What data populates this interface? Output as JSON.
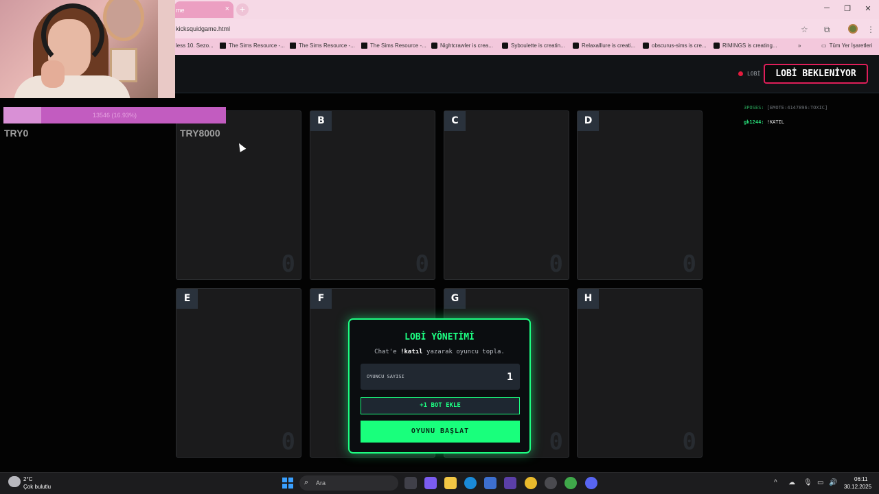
{
  "browser": {
    "tab_title": "me",
    "tab_close": "×",
    "new_tab": "+",
    "url": "kicksquidgame.html",
    "bookmarks": [
      "less 10. Sezo...",
      "The Sims Resource -...",
      "The Sims Resource -...",
      "The Sims Resource -...",
      "Nightcrawler is crea...",
      "Syboulette is creatin...",
      "Relaxalllure is creati...",
      "obscurus-sims is cre...",
      "RIMINGS is creating..."
    ],
    "bookmarks_more": "»",
    "all_bookmarks": "Tüm Yer İşaretleri"
  },
  "webcam": {
    "progress_text": "13546 (16.93%)",
    "progress_fraction": 0.17,
    "try_left": "TRY0",
    "try_right": "TRY8000"
  },
  "game": {
    "lobby_small": "LOBİ",
    "status": "LOBİ BEKLENİYOR",
    "slots": [
      {
        "letter": "",
        "count": "0"
      },
      {
        "letter": "B",
        "count": "0"
      },
      {
        "letter": "C",
        "count": "0"
      },
      {
        "letter": "D",
        "count": "0"
      },
      {
        "letter": "E",
        "count": "0"
      },
      {
        "letter": "F",
        "count": "0"
      },
      {
        "letter": "G",
        "count": "0"
      },
      {
        "letter": "H",
        "count": "0"
      }
    ],
    "chat": [
      {
        "user": "3POSES:",
        "message": "[EMOTE:4147896:TOXIC]"
      },
      {
        "user": "gk1244:",
        "message": "!KATIL"
      }
    ],
    "modal": {
      "title": "LOBİ YÖNETİMİ",
      "subtitle_pre": "Chat'e",
      "subtitle_cmd": "!katıl",
      "subtitle_post": "yazarak oyuncu topla.",
      "player_count_label": "OYUNCU SAYISI",
      "player_count_value": "1",
      "add_bot_label": "+1 BOT EKLE",
      "start_label": "OYUNU BAŞLAT"
    }
  },
  "taskbar": {
    "temperature": "2°C",
    "weather": "Çok bulutlu",
    "search_placeholder": "Ara",
    "time": "06:11",
    "date": "30.12.2025"
  },
  "colors": {
    "accent_green": "#1dff82",
    "status_border": "#e01e5a",
    "progress": "#c25cc0"
  }
}
